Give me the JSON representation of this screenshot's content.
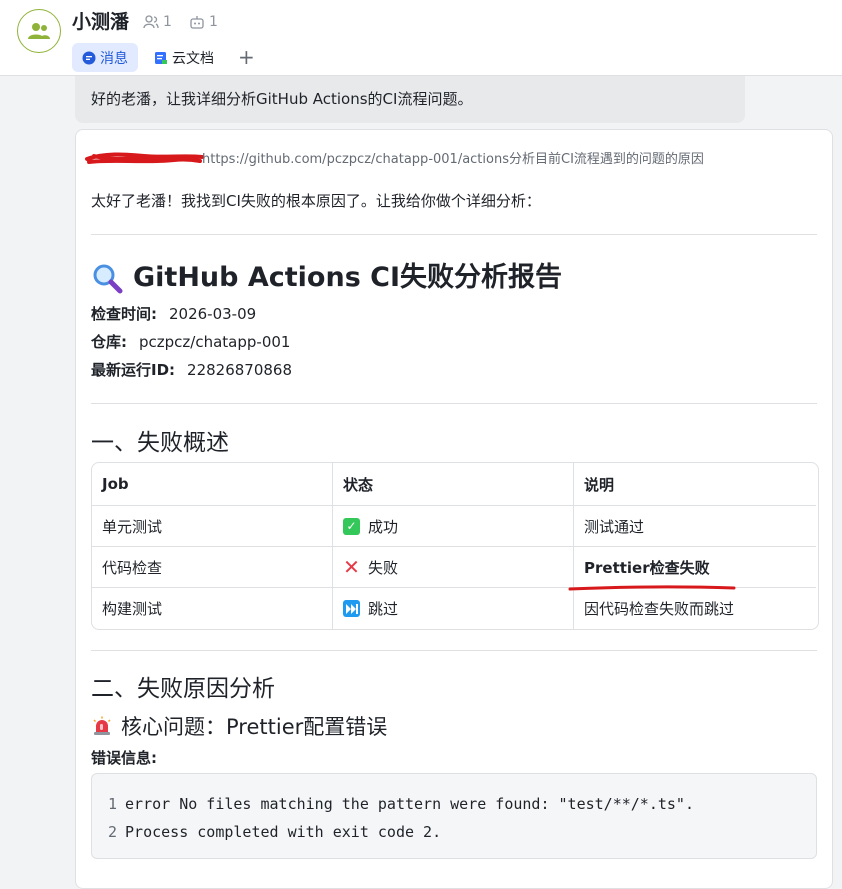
{
  "header": {
    "title": "小测潘",
    "members_count": "1",
    "bots_count": "1",
    "tabs": [
      {
        "label": "消息",
        "active": true
      },
      {
        "label": "云文档",
        "active": false
      }
    ],
    "add_tab": "+"
  },
  "user_message": "好的老潘，让我详细分析GitHub Actions的CI流程问题。",
  "reply": {
    "link_text": "https://github.com/pczpcz/chatapp-001/actions分析目前CI流程遇到的问题的原因",
    "intro": "太好了老潘！我找到CI失败的根本原因了。让我给你做个详细分析：",
    "report_title": "GitHub Actions CI失败分析报告",
    "check_time_label": "检查时间:",
    "check_time_value": "2026-03-09",
    "repo_label": "仓库:",
    "repo_value": "pczpcz/chatapp-001",
    "run_id_label": "最新运行ID:",
    "run_id_value": "22826870868",
    "section1_title": "一、失败概述",
    "table": {
      "headers": [
        "Job",
        "状态",
        "说明"
      ],
      "rows": [
        {
          "job": "单元测试",
          "status": "成功",
          "note": "测试通过"
        },
        {
          "job": "代码检查",
          "status": "失败",
          "note": "Prettier检查失败"
        },
        {
          "job": "构建测试",
          "status": "跳过",
          "note": "因代码检查失败而跳过"
        }
      ]
    },
    "section2_title": "二、失败原因分析",
    "core_issue_title": "核心问题：Prettier配置错误",
    "error_label": "错误信息:",
    "code_lines": [
      {
        "num": "1",
        "text": "error No files matching the pattern were found: \"test/**/*.ts\"."
      },
      {
        "num": "2",
        "text": "Process completed with exit code 2."
      }
    ]
  },
  "colors": {
    "accent": "#245bdb",
    "success": "#34c759",
    "fail": "#e63946",
    "skip": "#1e9bf0",
    "avatar_ring": "#8fb338",
    "annotation_red": "#d7191c"
  }
}
